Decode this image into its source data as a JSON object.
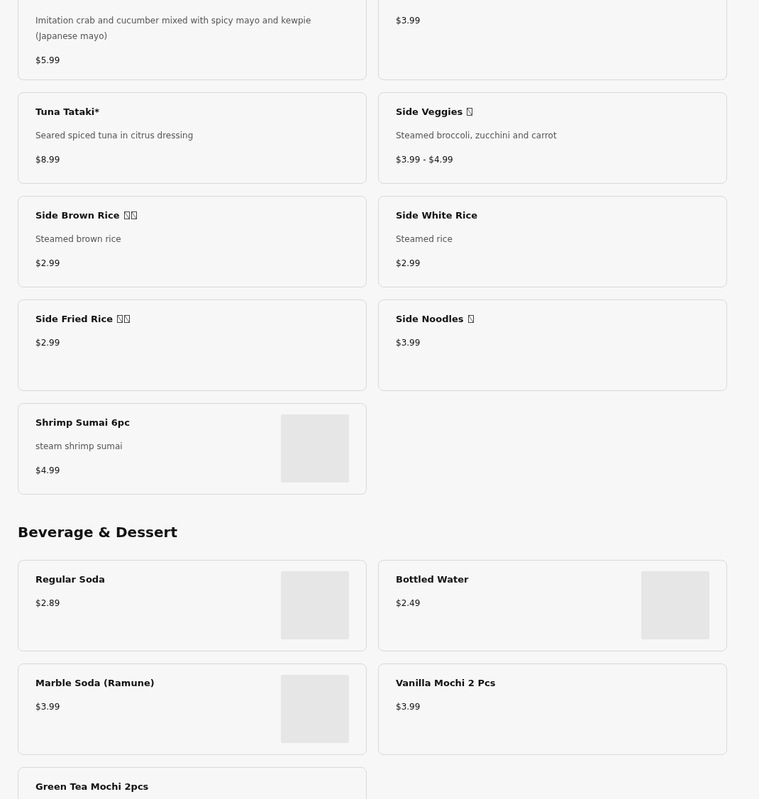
{
  "sections": [
    {
      "items": [
        {
          "description": "Imitation crab and cucumber mixed with spicy mayo and kewpie (Japanese mayo)",
          "price": "$5.99"
        },
        {
          "price": "$3.99"
        },
        {
          "name": "Tuna Tataki*",
          "description": "Seared spiced tuna in citrus dressing",
          "price": "$8.99"
        },
        {
          "name": "Side Veggies",
          "glyphs": [
            {
              "kind": "missing"
            }
          ],
          "description": "Steamed broccoli, zucchini and carrot",
          "price": "$3.99 - $4.99"
        },
        {
          "name": "Side Brown Rice",
          "glyphs": [
            {
              "kind": "missing"
            },
            {
              "kind": "missing"
            }
          ],
          "description": "Steamed brown rice",
          "price": "$2.99"
        },
        {
          "name": "Side White Rice",
          "description": "Steamed rice",
          "price": "$2.99"
        },
        {
          "name": "Side Fried Rice",
          "glyphs": [
            {
              "kind": "missing"
            },
            {
              "kind": "missing"
            }
          ],
          "price": "$2.99"
        },
        {
          "name": "Side Noodles",
          "glyphs": [
            {
              "kind": "missing"
            }
          ],
          "price": "$3.99"
        },
        {
          "name": "Shrimp Sumai 6pc",
          "description": "steam shrimp sumai",
          "price": "$4.99",
          "has_image": true
        }
      ]
    },
    {
      "title": "Beverage & Dessert",
      "items": [
        {
          "name": "Regular Soda",
          "price": "$2.89",
          "has_image": true
        },
        {
          "name": "Bottled Water",
          "price": "$2.49",
          "has_image": true
        },
        {
          "name": "Marble Soda (Ramune)",
          "price": "$3.99",
          "has_image": true
        },
        {
          "name": "Vanilla Mochi 2 Pcs",
          "price": "$3.99"
        },
        {
          "name": "Green Tea Mochi 2pcs"
        }
      ]
    }
  ]
}
